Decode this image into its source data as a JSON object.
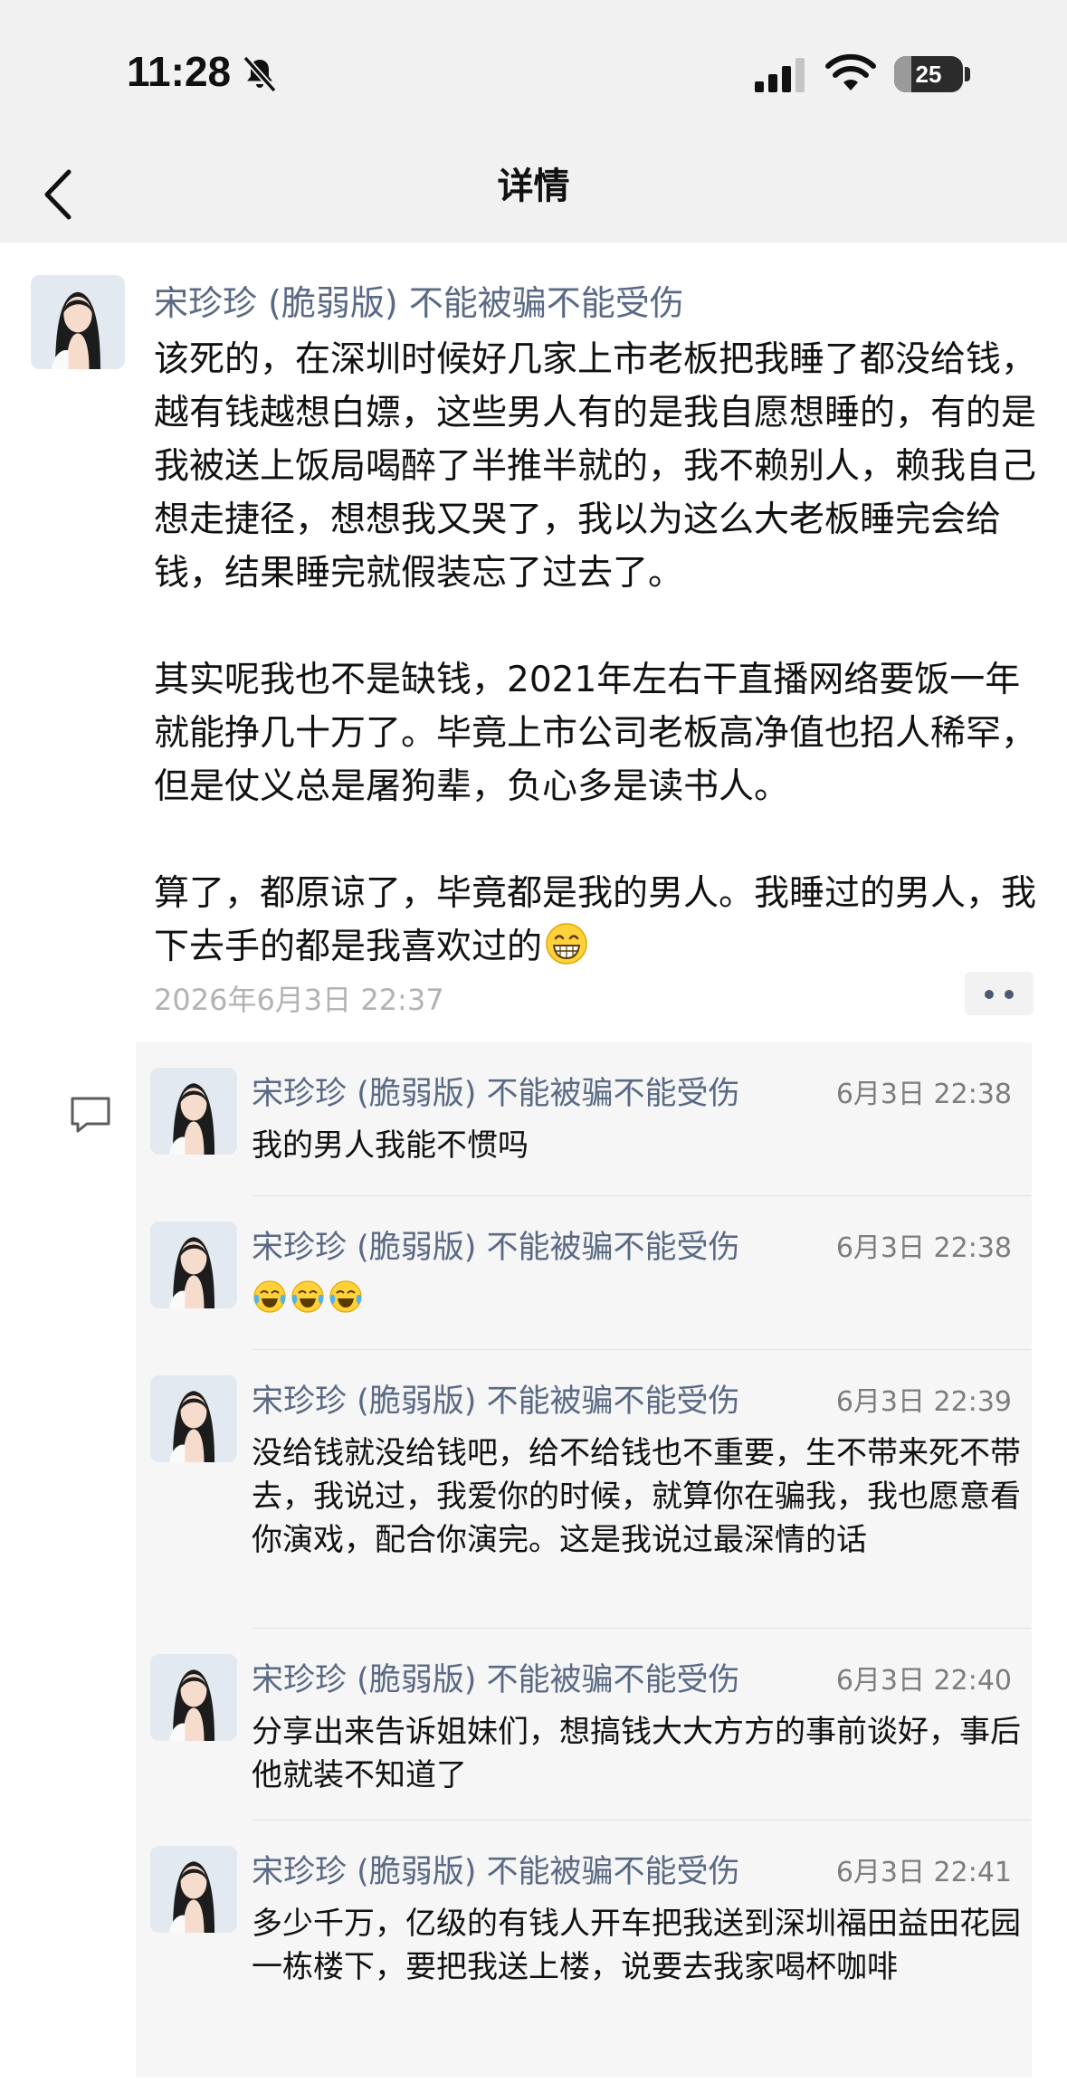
{
  "status_bar": {
    "time": "11:28",
    "battery": "25",
    "battery_level": 0.25
  },
  "nav": {
    "title": "详情"
  },
  "post": {
    "author": "宋珍珍 (脆弱版) 不能被骗不能受伤",
    "paragraphs": [
      "该死的，在深圳时候好几家上市老板把我睡了都没给钱，越有钱越想白嫖，这些男人有的是我自愿想睡的，有的是我被送上饭局喝醉了半推半就的，我不赖别人，赖我自己想走捷径，想想我又哭了，我以为这么大老板睡完会给钱，结果睡完就假装忘了过去了。",
      "其实呢我也不是缺钱，2021年左右干直播网络要饭一年就能挣几十万了。毕竟上市公司老板高净值也招人稀罕，但是仗义总是屠狗辈，负心多是读书人。",
      "算了，都原谅了，毕竟都是我的男人。我睡过的男人，我下去手的都是我喜欢过的"
    ],
    "trailing_emoji": "grinning-face-emoji",
    "timestamp": "2026年6月3日 22:37"
  },
  "comments": [
    {
      "author": "宋珍珍 (脆弱版) 不能被骗不能受伤",
      "time": "6月3日 22:38",
      "text": "我的男人我能不惯吗",
      "emojis": []
    },
    {
      "author": "宋珍珍 (脆弱版) 不能被骗不能受伤",
      "time": "6月3日 22:38",
      "text": "",
      "emojis": [
        "crying-laughing-emoji",
        "crying-laughing-emoji",
        "crying-laughing-emoji"
      ]
    },
    {
      "author": "宋珍珍 (脆弱版) 不能被骗不能受伤",
      "time": "6月3日 22:39",
      "text": "没给钱就没给钱吧，给不给钱也不重要，生不带来死不带去，我说过，我爱你的时候，就算你在骗我，我也愿意看你演戏，配合你演完。这是我说过最深情的话",
      "emojis": []
    },
    {
      "author": "宋珍珍 (脆弱版) 不能被骗不能受伤",
      "time": "6月3日 22:40",
      "text": "分享出来告诉姐妹们，想搞钱大大方方的事前谈好，事后他就装不知道了",
      "emojis": []
    },
    {
      "author": "宋珍珍 (脆弱版) 不能被骗不能受伤",
      "time": "6月3日 22:41",
      "text": "多少千万，亿级的有钱人开车把我送到深圳福田益田花园一栋楼下，要把我送上楼，说要去我家喝杯咖啡",
      "emojis": []
    }
  ],
  "colors": {
    "author": "#5a6a85",
    "timestamp": "#b2b2b2",
    "comment_bg": "#f6f6f6",
    "header_bg": "#f1f1f1"
  }
}
